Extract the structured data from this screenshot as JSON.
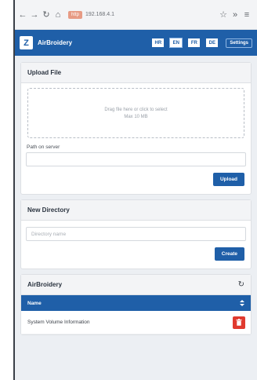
{
  "browser": {
    "url_badge": "http",
    "url": "192.168.4.1"
  },
  "navbar": {
    "logo_text": "Z",
    "title": "AirBroidery",
    "languages": [
      "HR",
      "EN",
      "FR",
      "DE"
    ],
    "active_language": "EN",
    "settings_label": "Settings"
  },
  "upload": {
    "title": "Upload File",
    "dropzone_text": "Drag file here or click to select",
    "dropzone_subtext": "Max 10 MB",
    "path_label": "Path on server",
    "path_value": "",
    "upload_button": "Upload"
  },
  "new_directory": {
    "title": "New Directory",
    "placeholder": "Directory name",
    "create_button": "Create"
  },
  "files": {
    "title": "AirBroidery",
    "header_name": "Name",
    "rows": [
      {
        "name": "System Volume Information"
      }
    ]
  },
  "colors": {
    "primary": "#1f5fa8",
    "danger": "#e03a2f"
  }
}
